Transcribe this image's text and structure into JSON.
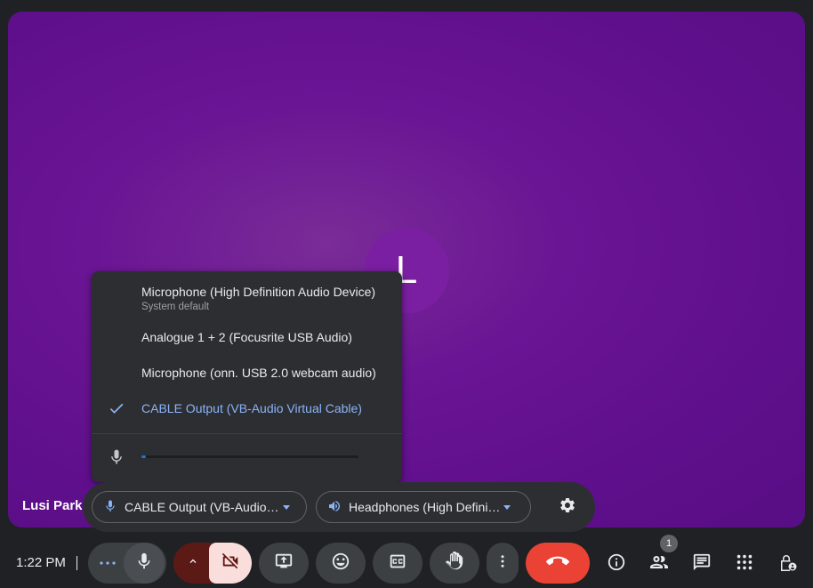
{
  "participant": {
    "initial": "L",
    "name": "Lusi Park"
  },
  "device_menu": {
    "items": [
      {
        "label": "Microphone (High Definition Audio Device)",
        "sublabel": "System default",
        "selected": false
      },
      {
        "label": "Analogue 1 + 2 (Focusrite USB Audio)",
        "selected": false
      },
      {
        "label": "Microphone (onn. USB 2.0 webcam audio)",
        "selected": false
      },
      {
        "label": "CABLE Output (VB-Audio Virtual Cable)",
        "selected": true
      }
    ],
    "input_level_fraction": 0.02
  },
  "device_bar": {
    "microphone_label": "CABLE Output (VB-Audio…",
    "speaker_label": "Headphones (High Defini…"
  },
  "toolbar": {
    "time": "1:22 PM",
    "people_count": "1"
  },
  "colors": {
    "stage_background": "#6a1594",
    "avatar": "#7b1fa2",
    "accent_blue": "#8ab4f8",
    "end_call_red": "#ea4335",
    "camera_off_bg": "#f9dedc"
  },
  "icons": {
    "check": "check-icon",
    "mic": "mic-icon",
    "speaker": "volume-icon",
    "settings": "gear-icon",
    "camera_off": "videocam-off-icon",
    "present": "present-screen-icon",
    "emoji": "emoji-icon",
    "captions": "closed-captions-icon",
    "hand": "raise-hand-icon",
    "end_call": "call-end-icon",
    "info": "info-icon",
    "people": "people-icon",
    "chat": "chat-icon",
    "activities": "apps-grid-icon",
    "host": "host-controls-icon"
  }
}
